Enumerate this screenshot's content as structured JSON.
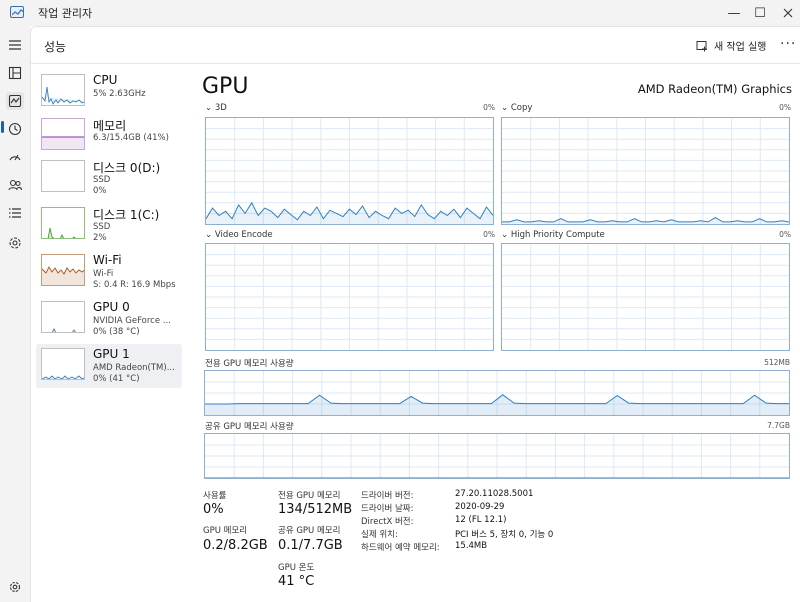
{
  "app": {
    "title": "작업 관리자"
  },
  "window": {
    "minimize": "—",
    "maximize": "☐"
  },
  "header": {
    "page_title": "성능",
    "new_task_label": "새 작업 실행",
    "more_label": "···"
  },
  "nav": {
    "icons": [
      "menu-icon",
      "processes-icon",
      "performance-icon",
      "app-history-icon",
      "startup-apps-icon",
      "users-icon",
      "details-icon",
      "services-icon"
    ],
    "bottom": "settings-icon"
  },
  "devices": [
    {
      "id": "cpu",
      "name": "CPU",
      "line2": "5%  2.63GHz",
      "line3": "",
      "color": "#2f80c3"
    },
    {
      "id": "memory",
      "name": "메모리",
      "line2": "6.3/15.4GB (41%)",
      "line3": "",
      "color": "#8e2ea8"
    },
    {
      "id": "disk0",
      "name": "디스크 0(D:)",
      "line2": "SSD",
      "line3": "0%",
      "color": "#4a9a34"
    },
    {
      "id": "disk1",
      "name": "디스크 1(C:)",
      "line2": "SSD",
      "line3": "2%",
      "color": "#4a9a34"
    },
    {
      "id": "wifi",
      "name": "Wi-Fi",
      "line2": "Wi-Fi",
      "line3": "S: 0.4  R: 16.9 Mbps",
      "color": "#a4531c"
    },
    {
      "id": "gpu0",
      "name": "GPU 0",
      "line2": "NVIDIA GeForce ...",
      "line3": "0% (38 °C)",
      "color": "#2f80c3"
    },
    {
      "id": "gpu1",
      "name": "GPU 1",
      "line2": "AMD Radeon(TM)...",
      "line3": "0% (41 °C)",
      "color": "#2f80c3"
    }
  ],
  "gpu": {
    "title": "GPU",
    "name": "AMD Radeon(TM) Graphics",
    "engines": [
      {
        "label": "3D",
        "value": "0%"
      },
      {
        "label": "Copy",
        "value": "0%"
      },
      {
        "label": "Video Encode",
        "value": "0%"
      },
      {
        "label": "High Priority Compute",
        "value": "0%"
      }
    ],
    "dedicated": {
      "label": "전용 GPU 메모리 사용량",
      "max": "512MB"
    },
    "shared": {
      "label": "공유 GPU 메모리 사용량",
      "max": "7.7GB"
    }
  },
  "stats": {
    "usage_label": "사용률",
    "usage_value": "0%",
    "gpu_mem_label": "GPU 메모리",
    "gpu_mem_value": "0.2/8.2GB",
    "dedicated_label": "전용 GPU 메모리",
    "dedicated_value": "134/512MB",
    "shared_label": "공유 GPU 메모리",
    "shared_value": "0.1/7.7GB",
    "temp_label": "GPU 온도",
    "temp_value": "41 °C"
  },
  "details": [
    {
      "key": "드라이버 버전:",
      "value": "27.20.11028.5001"
    },
    {
      "key": "드라이버 날짜:",
      "value": "2020-09-29"
    },
    {
      "key": "DirectX 버전:",
      "value": "12 (FL 12.1)"
    },
    {
      "key": "실제 위치:",
      "value": "PCI 버스 5, 장치 0, 기능 0"
    },
    {
      "key": "하드웨어 예약 메모리:",
      "value": "15.4MB"
    }
  ]
}
